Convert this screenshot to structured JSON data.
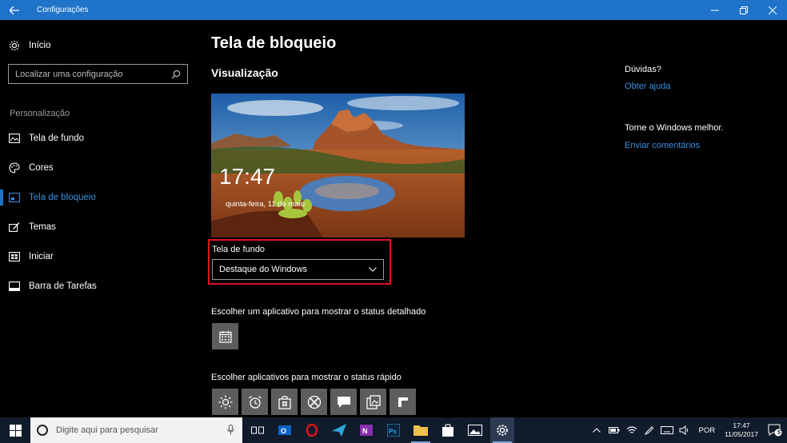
{
  "window": {
    "title": "Configurações",
    "back_icon": "arrow-left-icon",
    "controls": [
      "minimize-icon",
      "restore-icon",
      "close-icon"
    ]
  },
  "sidebar": {
    "home_label": "Início",
    "search_placeholder": "Localizar uma configuração",
    "section_label": "Personalização",
    "items": [
      {
        "label": "Tela de fundo",
        "icon": "picture-icon"
      },
      {
        "label": "Cores",
        "icon": "palette-icon"
      },
      {
        "label": "Tela de bloqueio",
        "icon": "lock-screen-icon",
        "active": true
      },
      {
        "label": "Temas",
        "icon": "brush-icon"
      },
      {
        "label": "Iniciar",
        "icon": "start-grid-icon"
      },
      {
        "label": "Barra de Tarefas",
        "icon": "taskbar-icon"
      }
    ]
  },
  "main": {
    "title": "Tela de bloqueio",
    "preview_heading": "Visualização",
    "lock_time": "17:47",
    "lock_date": "quinta-feira, 11 de maio",
    "background_label": "Tela de fundo",
    "background_value": "Destaque do Windows",
    "detailed_status_label": "Escolher um aplicativo para mostrar o status detalhado",
    "quick_status_label": "Escolher aplicativos para mostrar o status rápido",
    "detailed_app_icon": "calendar-icon",
    "quick_app_icons": [
      "weather-sun-icon",
      "alarm-clock-icon",
      "store-icon",
      "xbox-icon",
      "message-icon",
      "photos-icon",
      "corner-icon"
    ]
  },
  "right": {
    "help_heading": "Dúvidas?",
    "help_link": "Obter ajuda",
    "feedback_heading": "Torne o Windows melhor.",
    "feedback_link": "Enviar comentários"
  },
  "taskbar": {
    "search_placeholder": "Digite aqui para pesquisar",
    "language": "POR",
    "time": "17:47",
    "date": "11/05/2017",
    "notification_count": "5"
  },
  "colors": {
    "accent": "#1f73c9",
    "link": "#3a8fe0",
    "highlight": "#e0141e"
  }
}
